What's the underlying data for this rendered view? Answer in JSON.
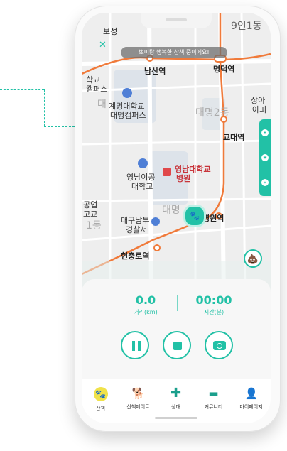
{
  "colors": {
    "accent": "#22c1a6",
    "route": "#f07a3a",
    "stations": "#f07a3a",
    "map_bg": "#eeeeee"
  },
  "map": {
    "top_partial_left": "보성",
    "top_partial_right": "9인1동",
    "close_icon": "close-icon",
    "banner": "뽀미랑 행복한 산책 중이에요!",
    "stations": [
      "남산역",
      "명덕역",
      "교대역",
      "병원역",
      "현충로역"
    ],
    "places": {
      "hakgyo": "학교",
      "campus": "캠퍼스",
      "keimyung_big": "대",
      "keimyung_line1": "계명대학교",
      "keimyung_line2": "대명캠퍼스",
      "sanga_line1": "상아",
      "sanga_line2": "아피",
      "daemyeong2": "대명2동",
      "yeongnam_it_1": "영남이공",
      "yeongnam_it_2": "대학교",
      "yu_hospital_1": "영남대학교",
      "yu_hospital_2": "병원",
      "daemyeong_faint": "대명",
      "left_edge_1": "공업",
      "left_edge_2": "고교",
      "left_1dong": "1동",
      "police_1": "대구남부",
      "police_2": "경찰서"
    }
  },
  "stats": {
    "distance_value": "0.0",
    "distance_label": "거리(km)",
    "time_value": "00:00",
    "time_label": "시간(분)"
  },
  "controls": {
    "pause": "pause-icon",
    "stop": "stop-icon",
    "camera": "camera-icon"
  },
  "nav": {
    "items": [
      {
        "label": "산책",
        "icon": "paw-icon",
        "active": true
      },
      {
        "label": "산책메이트",
        "icon": "dog-icon"
      },
      {
        "label": "상태",
        "icon": "medical-cross-icon"
      },
      {
        "label": "커뮤니티",
        "icon": "chat-icon"
      },
      {
        "label": "마이페이지",
        "icon": "person-icon"
      }
    ]
  }
}
